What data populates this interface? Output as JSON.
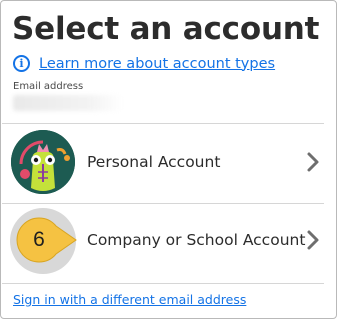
{
  "page": {
    "title": "Select an account"
  },
  "info": {
    "icon": "info-circle-icon",
    "link_text": "Learn more about account types",
    "accent_color": "#1473e6"
  },
  "email": {
    "label": "Email address",
    "value": ""
  },
  "accounts": [
    {
      "label": "Personal Account",
      "icon": "personal-avatar-icon",
      "chevron": "chevron-right-icon"
    },
    {
      "label": "Company or School Account",
      "icon": "company-icon",
      "chevron": "chevron-right-icon",
      "step_badge": "6",
      "step_badge_color": "#f5c242"
    }
  ],
  "footer": {
    "link_text": "Sign in with a different email address"
  }
}
